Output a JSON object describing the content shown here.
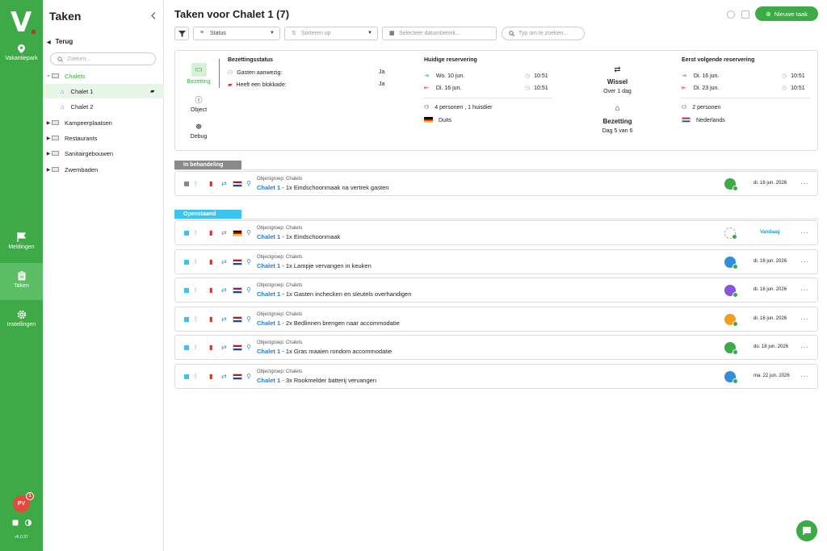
{
  "rail": {
    "logo": "V",
    "park_label": "Vakantiepark",
    "nav": [
      {
        "label": "Meldingen",
        "icon": "flag-icon"
      },
      {
        "label": "Taken",
        "icon": "clipboard-icon",
        "active": true
      },
      {
        "label": "Instellingen",
        "icon": "gear-icon"
      }
    ],
    "avatar_initials": "PV",
    "avatar_badge": "1",
    "version": "v6.0.37"
  },
  "tree": {
    "title": "Taken",
    "back_label": "Terug",
    "search_placeholder": "Zoeken...",
    "items": [
      {
        "label": "Chalets",
        "level": 0,
        "open": true,
        "color": "#3daa47"
      },
      {
        "label": "Chalet 1",
        "level": 1,
        "selected": true
      },
      {
        "label": "Chalet 2",
        "level": 1
      },
      {
        "label": "Kampeerplaatsen",
        "level": 0
      },
      {
        "label": "Restaurants",
        "level": 0
      },
      {
        "label": "Sanitairgebouwen",
        "level": 0
      },
      {
        "label": "Zwembaden",
        "level": 0
      }
    ]
  },
  "header": {
    "title": "Taken voor Chalet 1 (7)",
    "new_task_label": "Nieuwe taak"
  },
  "filters": {
    "status_label": "Status",
    "sort_placeholder": "Sorteren op",
    "date_placeholder": "Selecteer datumbereik...",
    "search_placeholder": "Typ om te zoeken..."
  },
  "card": {
    "tabs": [
      "Bezetting",
      "Object",
      "Debug"
    ],
    "status_title": "Bezettingsstatus",
    "guests_label": "Gasten aanwezig:",
    "guests_value": "Ja",
    "block_label": "Heeft een blokkade:",
    "block_value": "Ja",
    "current_title": "Huidige reservering",
    "current_in_date": "Wo. 10 jun.",
    "current_in_time": "10:51",
    "current_out_date": "Di. 16 jun.",
    "current_out_time": "10:51",
    "current_people": "4 personen , 1 huisdier",
    "current_lang": "Duits",
    "switch_title": "Wissel",
    "switch_sub": "Over 1 dag",
    "occ_title": "Bezetting",
    "occ_sub": "Dag 5 van 6",
    "next_title": "Eerst volgende reservering",
    "next_in_date": "Di. 16 jun.",
    "next_in_time": "10:51",
    "next_out_date": "Di. 23 jun.",
    "next_out_time": "10:51",
    "next_people": "2 personen",
    "next_lang": "Nederlands"
  },
  "sections": [
    {
      "label": "In behandeling",
      "color": "#8a8a8a"
    },
    {
      "label": "Openstaand",
      "color": "#3cc4f0"
    }
  ],
  "tasks": [
    {
      "group": "Objectgroep: Chalets",
      "object": "Chalet 1",
      "text": " - 1x Eindschoonmaak na vertrek gasten",
      "date": "di. 16 jun. 2026",
      "section": 0,
      "sq": "#888",
      "who": "#3daa47",
      "flag": "nl"
    },
    {
      "group": "Objectgroep: Chalets",
      "object": "Chalet 1",
      "text": " - 1x Eindschoonmaak",
      "date": "Vandaag",
      "section": 1,
      "sq": "#3cc4f0",
      "who": "",
      "flag": "de"
    },
    {
      "group": "Objectgroep: Chalets",
      "object": "Chalet 1",
      "text": " - 1x Lampje vervangen in keuken",
      "date": "di. 16 jun. 2026",
      "section": 1,
      "sq": "#3cc4f0",
      "who": "#2f8fd8",
      "flag": "nl"
    },
    {
      "group": "Objectgroep: Chalets",
      "object": "Chalet 1",
      "text": " - 1x Gasten inchecken en sleutels overhandigen",
      "date": "di. 16 jun. 2026",
      "section": 1,
      "sq": "#3cc4f0",
      "who": "#8a55d8",
      "flag": "nl"
    },
    {
      "group": "Objectgroep: Chalets",
      "object": "Chalet 1",
      "text": " - 2x Bedlinnen brengen naar accommodatie",
      "date": "di. 16 jun. 2026",
      "section": 1,
      "sq": "#3cc4f0",
      "who": "#f0a020",
      "flag": "nl"
    },
    {
      "group": "Objectgroep: Chalets",
      "object": "Chalet 1",
      "text": " - 1x Gras maaien rondom accommodatie",
      "date": "do. 18 jun. 2026",
      "section": 1,
      "sq": "#3cc4f0",
      "who": "#3daa47",
      "flag": "nl"
    },
    {
      "group": "Objectgroep: Chalets",
      "object": "Chalet 1",
      "text": " - 3x Rookmelder batterij vervangen",
      "date": "ma. 22 jun. 2026",
      "section": 1,
      "sq": "#3cc4f0",
      "who": "#2f8fd8",
      "flag": "nl"
    }
  ]
}
